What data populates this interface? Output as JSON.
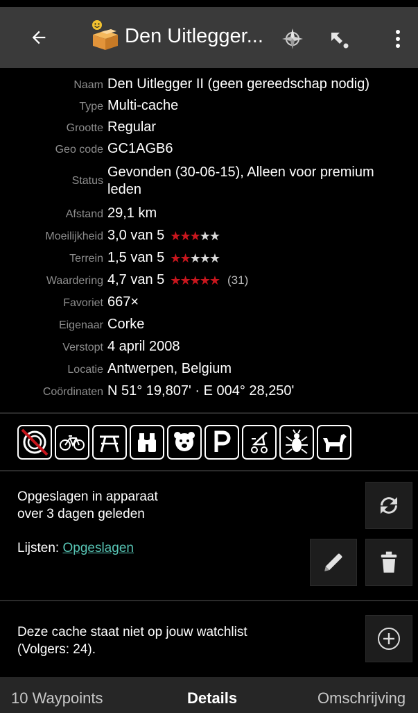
{
  "appbar": {
    "title": "Den Uitlegger..."
  },
  "details": [
    {
      "label": "Naam",
      "value": "Den Uitlegger II (geen gereedschap nodig)"
    },
    {
      "label": "Type",
      "value": "Multi-cache"
    },
    {
      "label": "Grootte",
      "value": "Regular"
    },
    {
      "label": "Geo code",
      "value": "GC1AGB6"
    },
    {
      "label": "Status",
      "value": "Gevonden (30-06-15), Alleen voor premium leden"
    },
    {
      "label": "Afstand",
      "value": "29,1 km"
    },
    {
      "label": "Moeilijkheid",
      "value": "3,0 van 5",
      "rating": 3.0
    },
    {
      "label": "Terrein",
      "value": "1,5 van 5",
      "rating": 1.5
    },
    {
      "label": "Waardering",
      "value": "4,7 van 5",
      "rating": 4.7,
      "votes": "(31)"
    },
    {
      "label": "Favoriet",
      "value": "667×"
    },
    {
      "label": "Eigenaar",
      "value": "Corke"
    },
    {
      "label": "Verstopt",
      "value": "4 april 2008"
    },
    {
      "label": "Locatie",
      "value": "Antwerpen, Belgium"
    },
    {
      "label": "Coördinaten",
      "value": "N 51° 19,807' · E 004° 28,250'"
    }
  ],
  "attributes": [
    "no-night-cache-icon",
    "bicycles-icon",
    "picnic-table-icon",
    "binoculars-icon",
    "kids-icon",
    "parking-icon",
    "stroller-icon",
    "ticks-icon",
    "dogs-icon"
  ],
  "stored": {
    "line1": "Opgeslagen in apparaat",
    "line2": "over 3 dagen geleden",
    "lists_label": "Lijsten: ",
    "lists_link": "Opgeslagen"
  },
  "watchlist": {
    "line1": "Deze cache staat niet op jouw watchlist",
    "line2": "(Volgers: 24)."
  },
  "tabs": {
    "waypoints": "10 Waypoints",
    "details": "Details",
    "description": "Omschrijving"
  },
  "colors": {
    "appbar": "#3a3a3a",
    "star_active": "#c8161d",
    "link": "#58c6b6"
  }
}
